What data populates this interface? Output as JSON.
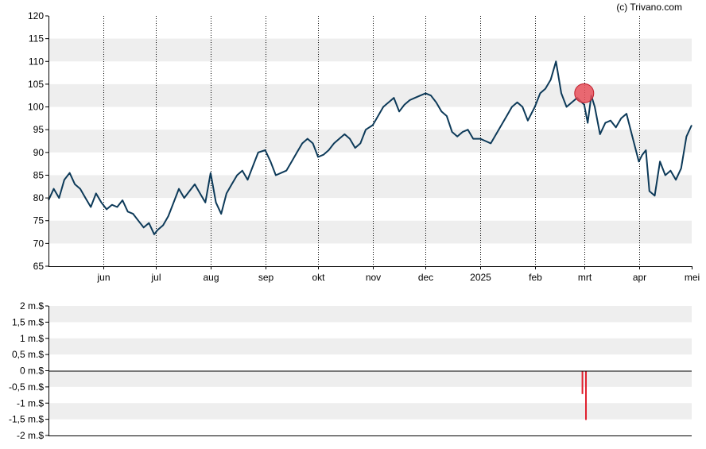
{
  "credit": "(c) Trivano.com",
  "colors": {
    "band": "#eeeeee",
    "price_line": "#0d3a59",
    "marker_fill": "#e8505b",
    "marker_stroke": "#c0202e",
    "volume_bar": "#e0202e",
    "axis": "#000000"
  },
  "chart_data": [
    {
      "type": "line",
      "x_tick_labels": [
        "jun",
        "jul",
        "aug",
        "sep",
        "okt",
        "nov",
        "dec",
        "2025",
        "feb",
        "mrt",
        "apr",
        "mei"
      ],
      "y_tick_labels": [
        "65",
        "70",
        "75",
        "80",
        "85",
        "90",
        "95",
        "100",
        "105",
        "110",
        "115",
        "120"
      ],
      "ylim": [
        65,
        120
      ],
      "x_range": [
        "2024-05-01",
        "2025-05-01"
      ],
      "grid": "alternating horizontal bands, dotted vertical lines at month starts",
      "series": [
        {
          "x": [
            "2024-05-01",
            "2024-05-04",
            "2024-05-07",
            "2024-05-10",
            "2024-05-13",
            "2024-05-16",
            "2024-05-19",
            "2024-05-22",
            "2024-05-25",
            "2024-05-28",
            "2024-05-31",
            "2024-06-03",
            "2024-06-06",
            "2024-06-09",
            "2024-06-12",
            "2024-06-15",
            "2024-06-18",
            "2024-06-21",
            "2024-06-24",
            "2024-06-27",
            "2024-06-30",
            "2024-07-02",
            "2024-07-05",
            "2024-07-08",
            "2024-07-11",
            "2024-07-14",
            "2024-07-17",
            "2024-07-20",
            "2024-07-23",
            "2024-07-26",
            "2024-07-29",
            "2024-08-01",
            "2024-08-04",
            "2024-08-07",
            "2024-08-10",
            "2024-08-13",
            "2024-08-16",
            "2024-08-19",
            "2024-08-22",
            "2024-08-25",
            "2024-08-28",
            "2024-09-01",
            "2024-09-04",
            "2024-09-07",
            "2024-09-10",
            "2024-09-13",
            "2024-09-16",
            "2024-09-19",
            "2024-09-22",
            "2024-09-25",
            "2024-09-28",
            "2024-10-01",
            "2024-10-04",
            "2024-10-07",
            "2024-10-10",
            "2024-10-13",
            "2024-10-16",
            "2024-10-19",
            "2024-10-22",
            "2024-10-25",
            "2024-10-28",
            "2024-11-01",
            "2024-11-04",
            "2024-11-07",
            "2024-11-10",
            "2024-11-13",
            "2024-11-16",
            "2024-11-19",
            "2024-11-22",
            "2024-11-25",
            "2024-11-28",
            "2024-12-01",
            "2024-12-04",
            "2024-12-07",
            "2024-12-10",
            "2024-12-13",
            "2024-12-16",
            "2024-12-19",
            "2024-12-22",
            "2024-12-25",
            "2024-12-28",
            "2025-01-01",
            "2025-01-04",
            "2025-01-07",
            "2025-01-10",
            "2025-01-13",
            "2025-01-16",
            "2025-01-19",
            "2025-01-22",
            "2025-01-25",
            "2025-01-28",
            "2025-02-01",
            "2025-02-04",
            "2025-02-07",
            "2025-02-10",
            "2025-02-13",
            "2025-02-16",
            "2025-02-19",
            "2025-02-22",
            "2025-02-25",
            "2025-03-01",
            "2025-03-03",
            "2025-03-05",
            "2025-03-07",
            "2025-03-10",
            "2025-03-13",
            "2025-03-16",
            "2025-03-19",
            "2025-03-22",
            "2025-03-25",
            "2025-03-28",
            "2025-04-01",
            "2025-04-03",
            "2025-04-05",
            "2025-04-07",
            "2025-04-10",
            "2025-04-13",
            "2025-04-16",
            "2025-04-19",
            "2025-04-22",
            "2025-04-25",
            "2025-04-28",
            "2025-05-01"
          ],
          "y": [
            79.5,
            82,
            80,
            84,
            85.5,
            83,
            82,
            80,
            78,
            81,
            79,
            77.5,
            78.5,
            78,
            79.5,
            77,
            76.5,
            75,
            73.5,
            74.5,
            72,
            73,
            74,
            76,
            79,
            82,
            80,
            81.5,
            83,
            81,
            79,
            85.5,
            79,
            76.5,
            81,
            83,
            85,
            86,
            84,
            87,
            90,
            90.5,
            88,
            85,
            85.5,
            86,
            88,
            90,
            92,
            93,
            92,
            89,
            89.5,
            90.5,
            92,
            93,
            94,
            93,
            91,
            92,
            95,
            96,
            98,
            100,
            101,
            102,
            99,
            100.5,
            101.5,
            102,
            102.5,
            103,
            102.5,
            101,
            99,
            98,
            94.5,
            93.5,
            94.5,
            95,
            93,
            93,
            92.5,
            92,
            94,
            96,
            98,
            100,
            101,
            100,
            97,
            100,
            103,
            104,
            106,
            110,
            103,
            100,
            101,
            102,
            100.5,
            96.5,
            102.5,
            100,
            94,
            96.5,
            97,
            95.5,
            97.5,
            98.5,
            94,
            88,
            89.5,
            90.5,
            81.5,
            80.5,
            88,
            85,
            86,
            84,
            86.5,
            93.5,
            96
          ]
        }
      ],
      "marker": {
        "x": "2025-03-01",
        "y": 103
      }
    },
    {
      "type": "bar",
      "y_tick_labels": [
        "2 m.$",
        "1,5 m.$",
        "1 m.$",
        "0,5 m.$",
        "0 m.$",
        "-0,5 m.$",
        "-1 m.$",
        "-1,5 m.$",
        "-2 m.$"
      ],
      "ylim": [
        -2,
        2
      ],
      "series": [
        {
          "x": [
            "2025-02-28",
            "2025-03-02"
          ],
          "values": [
            -0.72,
            -1.52
          ]
        }
      ]
    }
  ]
}
